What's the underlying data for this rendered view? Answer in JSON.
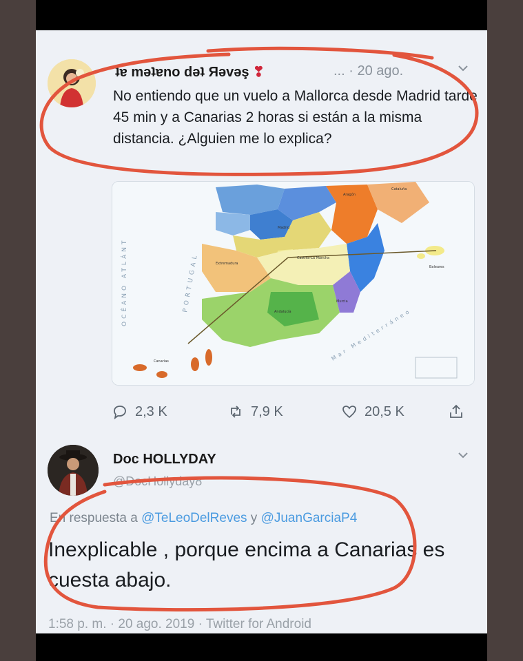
{
  "tweet": {
    "display_name": "ʇɐ məʇɐno dəʇ Яəvəş",
    "meta": "... · 20 ago.",
    "text": "No entiendo que un vuelo a Mallorca desde Madrid tarde 45 min y a Canarias 2 horas si están a la misma distancia. ¿Alguien me lo explica?",
    "map": {
      "ocean_label": "OCÉANO ATLÁNT",
      "portugal_label": "PORTUGAL",
      "med_label": "Mar Mediterráneo",
      "regions": [
        "Aragón",
        "Cataluña",
        "Madrid",
        "Castilla-La Mancha",
        "Extremadura",
        "Andalucía",
        "Murcia",
        "Baleares",
        "Canarias"
      ]
    },
    "actions": {
      "replies": "2,3 K",
      "retweets": "7,9 K",
      "likes": "20,5 K"
    }
  },
  "reply": {
    "display_name": "Doc HOLLYDAY",
    "handle": "@DocHollyday8",
    "replying_prefix": "En respuesta a",
    "mention1": "@TeLeoDelReves",
    "conj": "y",
    "mention2": "@JuanGarciaP4",
    "text": "Inexplicable , porque encima a Canarias es cuesta abajo.",
    "footer": "1:58 p. m. · 20 ago. 2019 · Twitter for Android"
  },
  "colors": {
    "annotation": "#e2553d",
    "card_bg": "#eef1f6",
    "link": "#4b9be0"
  }
}
